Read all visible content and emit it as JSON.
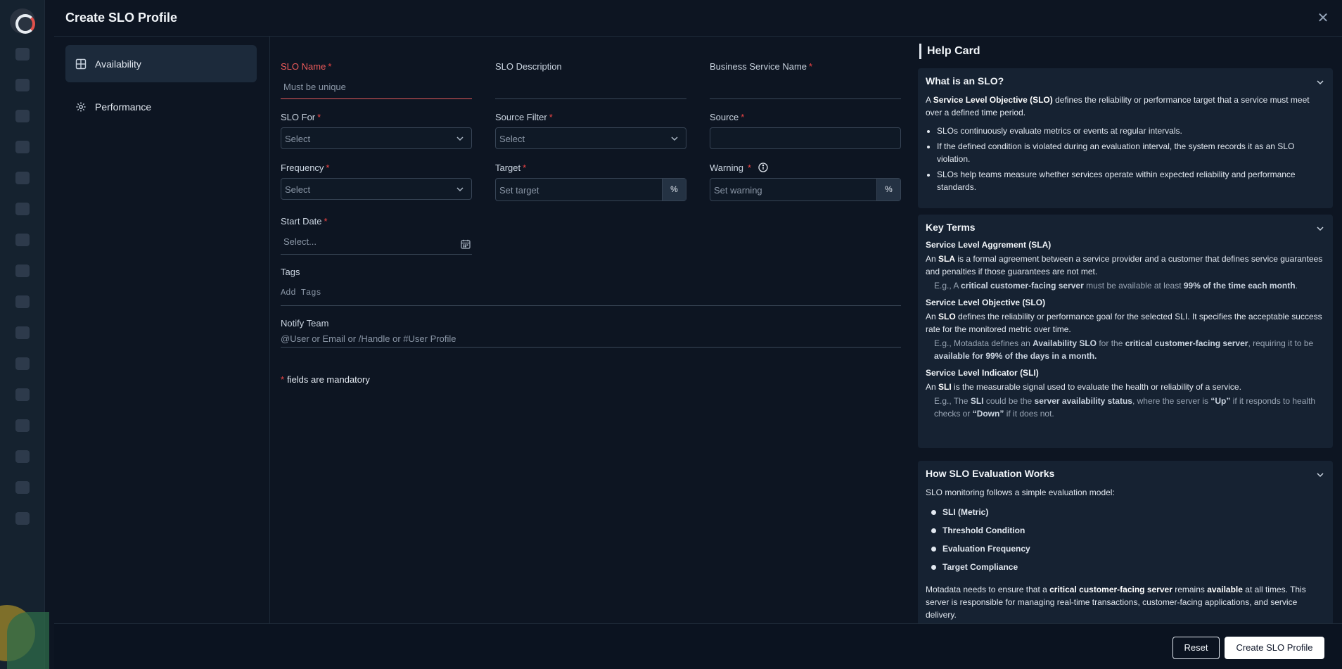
{
  "modal": {
    "title": "Create SLO Profile",
    "close_icon": "close-icon"
  },
  "sidebar": {
    "items": [
      {
        "label": "Availability",
        "icon": "grid-icon",
        "active": true
      },
      {
        "label": "Performance",
        "icon": "gear-icon",
        "active": false
      }
    ]
  },
  "form": {
    "slo_name": {
      "label": "SLO Name",
      "required": "*",
      "placeholder": "Must be unique"
    },
    "slo_description": {
      "label": "SLO Description"
    },
    "business_service_name": {
      "label": "Business Service Name",
      "required": "*"
    },
    "slo_for": {
      "label": "SLO For",
      "required": "*",
      "value": "Select"
    },
    "source_filter": {
      "label": "Source Filter",
      "required": "*",
      "value": "Select"
    },
    "source": {
      "label": "Source",
      "required": "*"
    },
    "frequency": {
      "label": "Frequency",
      "required": "*",
      "value": "Select"
    },
    "target": {
      "label": "Target",
      "required": "*",
      "placeholder": "Set target",
      "suffix": "%"
    },
    "warning": {
      "label": "Warning",
      "required": "*",
      "placeholder": "Set warning",
      "suffix": "%"
    },
    "start_date": {
      "label": "Start Date",
      "required": "*",
      "placeholder": "Select..."
    },
    "tags": {
      "label": "Tags",
      "placeholder": "Add Tags"
    },
    "notify_team": {
      "label": "Notify Team",
      "placeholder": "@User or Email or /Handle or #User Profile"
    },
    "mandatory_note": {
      "star": "*",
      "text": "fields are mandatory"
    }
  },
  "help": {
    "title": "Help Card",
    "what_is": {
      "title": "What is an SLO?",
      "intro_a": "A ",
      "intro_b": "Service Level Objective (SLO)",
      "intro_c": " defines the reliability or performance target that a service must meet over a defined time period.",
      "bullets": [
        "SLOs continuously evaluate metrics or events at regular intervals.",
        "If the defined condition is violated during an evaluation interval, the system records it as an SLO violation.",
        "SLOs help teams measure whether services operate within expected reliability and performance standards."
      ]
    },
    "key_terms": {
      "title": "Key Terms",
      "sla": {
        "heading": "Service Level Aggrement (SLA)",
        "d1": "An ",
        "d2": "SLA",
        "d3": " is a formal agreement between a service provider and a customer that defines service guarantees and penalties if those guarantees are not met.",
        "e1": "E.g., A ",
        "e2": "critical customer-facing server",
        "e3": " must be available at least ",
        "e4": "99% of the time each month",
        "e5": "."
      },
      "slo": {
        "heading": "Service Level Objective (SLO)",
        "d1": "An ",
        "d2": "SLO",
        "d3": " defines the reliability or performance goal for the selected SLI. It specifies the acceptable success rate for the monitored metric over time.",
        "e1": "E.g., Motadata defines an ",
        "e2": "Availability SLO",
        "e3": " for the ",
        "e4": "critical customer-facing server",
        "e5": ", requiring it to be ",
        "e6": "available for 99% of the days in a month."
      },
      "sli": {
        "heading": "Service Level Indicator (SLI)",
        "d1": "An ",
        "d2": "SLI",
        "d3": " is the measurable signal used to evaluate the health or reliability of a service.",
        "e1": "E.g., The ",
        "e2": "SLI",
        "e3": " could be the ",
        "e4": "server availability status",
        "e5": ", where the server is ",
        "e6": "“Up”",
        "e7": " if it responds to health checks or ",
        "e8": "“Down”",
        "e9": " if it does not."
      }
    },
    "how": {
      "title": "How SLO Evaluation Works",
      "intro": "SLO monitoring follows a simple evaluation model:",
      "items": [
        "SLI (Metric)",
        "Threshold Condition",
        "Evaluation Frequency",
        "Target Compliance"
      ],
      "outro_a": "Motadata needs to ensure that a ",
      "outro_b": "critical customer-facing server",
      "outro_c": " remains ",
      "outro_d": "available",
      "outro_e": " at all times. This server is responsible for managing real-time transactions, customer-facing applications, and service delivery."
    }
  },
  "footer": {
    "reset_label": "Reset",
    "create_label": "Create SLO Profile"
  }
}
